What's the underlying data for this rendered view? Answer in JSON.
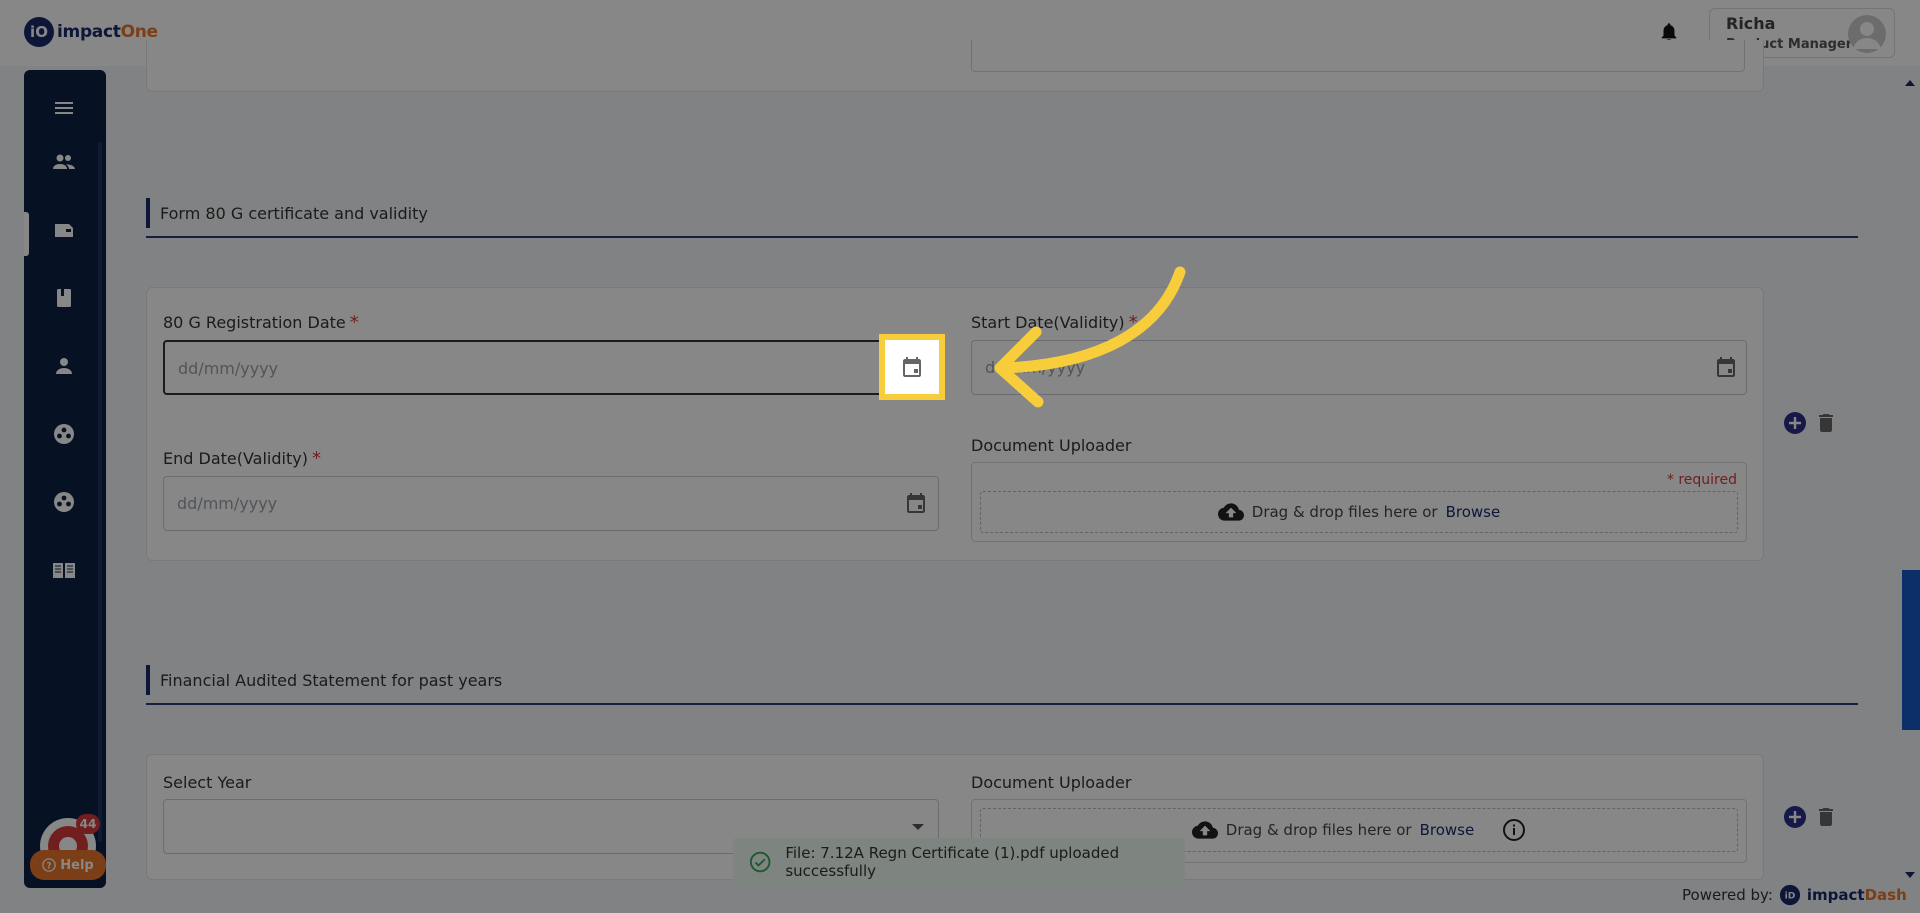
{
  "header": {
    "logo_mark": "iO",
    "logo_text_main": "impact",
    "logo_text_accent": "One",
    "user_name": "Richa",
    "user_role": "Product Manager"
  },
  "sidebar": {
    "items": [
      {
        "icon": "menu-icon"
      },
      {
        "icon": "people-icon"
      },
      {
        "icon": "wallet-icon"
      },
      {
        "icon": "book-icon"
      },
      {
        "icon": "person-icon"
      },
      {
        "icon": "group-circle-icon"
      },
      {
        "icon": "group-circle-icon"
      },
      {
        "icon": "open-book-icon"
      }
    ],
    "chat_count": "44",
    "help_label": "Help"
  },
  "section_80g": {
    "title": "Form 80 G certificate and validity",
    "registration_date_label": "80 G Registration Date",
    "registration_date_placeholder": "dd/mm/yyyy",
    "start_date_label": "Start Date(Validity)",
    "start_date_placeholder": "dd/mm/yyyy",
    "end_date_label": "End Date(Validity)",
    "end_date_placeholder": "dd/mm/yyyy",
    "uploader_label": "Document Uploader",
    "required_note": "* required",
    "drop_text": "Drag & drop files here or",
    "browse": "Browse",
    "required_mark": "*"
  },
  "section_financial": {
    "title": "Financial Audited Statement for past years",
    "select_year_label": "Select Year",
    "uploader_label": "Document Uploader",
    "drop_text": "Drag & drop files here or",
    "browse": "Browse"
  },
  "toast": {
    "message": "File: 7.12A Regn Certificate (1).pdf uploaded successfully"
  },
  "footer": {
    "powered_by": "Powered by:",
    "brand_main": "impact",
    "brand_accent": "Dash"
  },
  "colors": {
    "navy": "#0f2044",
    "accent_orange": "#e8762d",
    "required_red": "#d63a3a",
    "highlight_yellow": "#f7cd3c"
  }
}
